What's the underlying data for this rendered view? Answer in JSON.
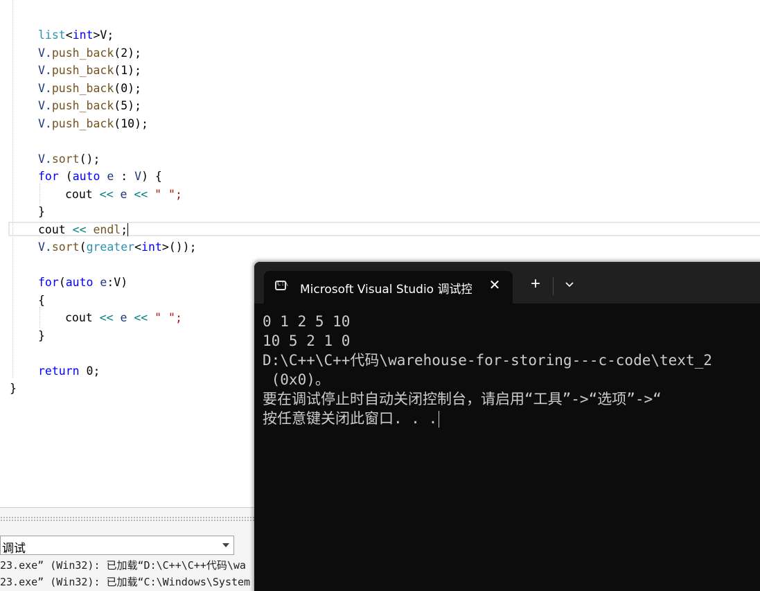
{
  "editor": {
    "lines": [
      [
        {
          "t": "list",
          "c": "ty"
        },
        {
          "t": "<",
          "c": "pl"
        },
        {
          "t": "int",
          "c": "kw"
        },
        {
          "t": ">V;",
          "c": "pl"
        }
      ],
      [
        {
          "t": "V.",
          "c": "id"
        },
        {
          "t": "push_back",
          "c": "fn"
        },
        {
          "t": "(2);",
          "c": "pl"
        }
      ],
      [
        {
          "t": "V.",
          "c": "id"
        },
        {
          "t": "push_back",
          "c": "fn"
        },
        {
          "t": "(1);",
          "c": "pl"
        }
      ],
      [
        {
          "t": "V.",
          "c": "id"
        },
        {
          "t": "push_back",
          "c": "fn"
        },
        {
          "t": "(0);",
          "c": "pl"
        }
      ],
      [
        {
          "t": "V.",
          "c": "id"
        },
        {
          "t": "push_back",
          "c": "fn"
        },
        {
          "t": "(5);",
          "c": "pl"
        }
      ],
      [
        {
          "t": "V.",
          "c": "id"
        },
        {
          "t": "push_back",
          "c": "fn"
        },
        {
          "t": "(10);",
          "c": "pl"
        }
      ],
      [
        {
          "t": "V.",
          "c": "id"
        },
        {
          "t": "sort",
          "c": "fn"
        },
        {
          "t": "();",
          "c": "pl"
        }
      ],
      [
        {
          "t": "for",
          "c": "kw"
        },
        {
          "t": " (",
          "c": "pl"
        },
        {
          "t": "auto",
          "c": "kw"
        },
        {
          "t": " e ",
          "c": "id"
        },
        {
          "t": ": ",
          "c": "pl"
        },
        {
          "t": "V",
          "c": "id"
        },
        {
          "t": ") {",
          "c": "pl"
        }
      ],
      [
        {
          "t": "cout ",
          "c": "pl"
        },
        {
          "t": "<<",
          "c": "op"
        },
        {
          "t": " e ",
          "c": "id"
        },
        {
          "t": "<<",
          "c": "op"
        },
        {
          "t": " \" \";",
          "c": "str"
        }
      ],
      [
        {
          "t": "}",
          "c": "pl"
        }
      ],
      [
        {
          "t": "cout ",
          "c": "pl"
        },
        {
          "t": "<<",
          "c": "op"
        },
        {
          "t": " endl",
          "c": "fn"
        },
        {
          "t": ";",
          "c": "pl"
        }
      ],
      [
        {
          "t": "V.",
          "c": "id"
        },
        {
          "t": "sort",
          "c": "fn"
        },
        {
          "t": "(",
          "c": "pl"
        },
        {
          "t": "greater",
          "c": "ty"
        },
        {
          "t": "<",
          "c": "pl"
        },
        {
          "t": "int",
          "c": "kw"
        },
        {
          "t": ">());",
          "c": "pl"
        }
      ],
      [
        {
          "t": "for",
          "c": "kw"
        },
        {
          "t": "(",
          "c": "pl"
        },
        {
          "t": "auto",
          "c": "kw"
        },
        {
          "t": " e",
          "c": "id"
        },
        {
          "t": ":V)",
          "c": "pl"
        }
      ],
      [
        {
          "t": "{",
          "c": "pl"
        }
      ],
      [
        {
          "t": "cout ",
          "c": "pl"
        },
        {
          "t": "<<",
          "c": "op"
        },
        {
          "t": " e ",
          "c": "id"
        },
        {
          "t": "<<",
          "c": "op"
        },
        {
          "t": " \" \";",
          "c": "str"
        }
      ],
      [
        {
          "t": "}",
          "c": "pl"
        }
      ],
      [
        {
          "t": "return",
          "c": "kw"
        },
        {
          "t": " 0;",
          "c": "pl"
        }
      ],
      [
        {
          "t": "}",
          "c": "pl"
        }
      ]
    ]
  },
  "terminal": {
    "tab_title": "Microsoft Visual Studio 调试控制台",
    "tab_icon": "terminal-icon",
    "close_icon": "close-icon",
    "new_tab_icon": "plus-icon",
    "dropdown_icon": "chevron-down-icon",
    "output_lines": [
      "0 1 2 5 10",
      "10 5 2 1 0",
      "D:\\C++\\C++代码\\warehouse-for-storing---c-code\\text_2",
      " (0x0)。",
      "要在调试停止时自动关闭控制台，请启用“工具”->“选项”->“",
      "按任意键关闭此窗口. . ."
    ]
  },
  "output_panel": {
    "source_label": "调试",
    "lines": [
      "23.exe” (Win32): 已加载“D:\\C++\\C++代码\\wa",
      "23.exe” (Win32): 已加载“C:\\Windows\\System"
    ]
  },
  "colors": {
    "keyword": "#0000ff",
    "type": "#2b91af",
    "operator": "#008080",
    "function": "#74531f",
    "identifier": "#1f377f",
    "string": "#a31515",
    "terminal_bg": "#0c0c0c",
    "terminal_titlebar": "#202020",
    "terminal_text": "#cccccc"
  }
}
